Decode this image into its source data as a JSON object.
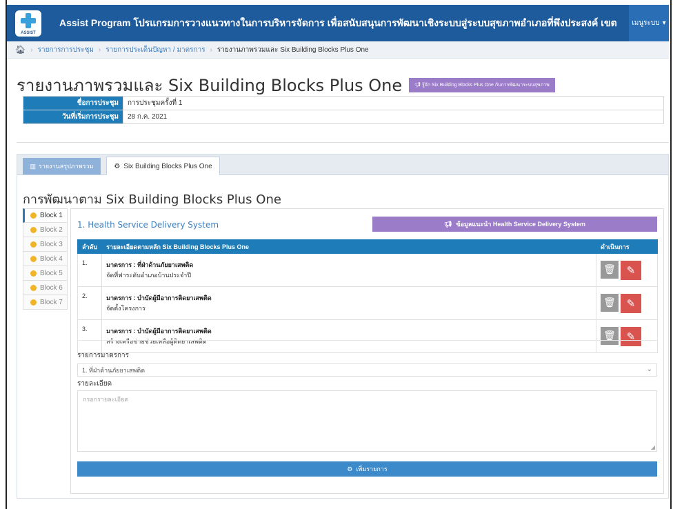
{
  "navbar": {
    "logo_text": "ASSIST",
    "title": "Assist Program โปรแกรมการวางแนวทางในการบริหารจัดการ เพื่อสนับสนุนการพัฒนาเชิงระบบสู่ระบบสุขภาพอำเภอที่พึงประสงค์ เขต",
    "menu_label": "เมนูระบบ",
    "menu_icon": "caret-down-icon",
    "brand_color": "#1e5b9c"
  },
  "breadcrumb": {
    "items": [
      "รายการการประชุม",
      "รายการประเด็นปัญหา / มาตรการ"
    ],
    "current": "รายงานภาพรวมและ Six Building Blocks Plus One"
  },
  "header": {
    "title": "รายงานภาพรวมและ Six Building Blocks Plus One",
    "badge": "รู้จัก Six Building Blocks Plus One กับการพัฒนาระบบสุขภาพ"
  },
  "meeting": {
    "name_label": "ชื่อการประชุม",
    "name_value": "การประชุมครั้งที่ 1",
    "date_label": "วันที่เริ่มการประชุม",
    "date_value": "28 ก.ค. 2021"
  },
  "tabs": [
    {
      "label": "รายงานสรุปภาพรวม",
      "icon": "bar-chart-icon"
    },
    {
      "label": "Six Building Blocks Plus One",
      "icon": "gear-icon"
    }
  ],
  "section_title": "การพัฒนาตาม Six Building Blocks Plus One",
  "blocks": [
    "Block 1",
    "Block 2",
    "Block 3",
    "Block 4",
    "Block 5",
    "Block 6",
    "Block 7"
  ],
  "block_content": {
    "title": "1. Health Service Delivery System",
    "info_button": "ข้อมูลแนะนำ Health Service Delivery System",
    "table": {
      "headers": [
        "ลำดับ",
        "รายละเอียดตามหลัก Six Building Blocks Plus One",
        "ดำเนินการ"
      ],
      "rows": [
        {
          "num": "1.",
          "measure": "มาตรการ : ที่ฝ่าด้านภัยยาเสพติด",
          "detail": "จัดที่ฟาระดับอำเภอบ้านประจำปี"
        },
        {
          "num": "2.",
          "measure": "มาตรการ : บำบัดผู้มีอาการติดยาเสพติด",
          "detail": "จัดตั้งโครงการ"
        },
        {
          "num": "3.",
          "measure": "มาตรการ : บำบัดผู้มีอาการติดยาเสพติด",
          "detail": "สร้างเครือข่ายช่วยเหลือผู้ติดยาเสพติด"
        }
      ]
    },
    "form": {
      "measure_label": "รายการมาตรการ",
      "measure_selected": "1. ที่ฝ่าด้านภัยยาเสพติด",
      "detail_label": "รายละเอียด",
      "detail_placeholder": "กรอกรายละเอียด",
      "add_button": "เพิ่มรายการ"
    }
  }
}
